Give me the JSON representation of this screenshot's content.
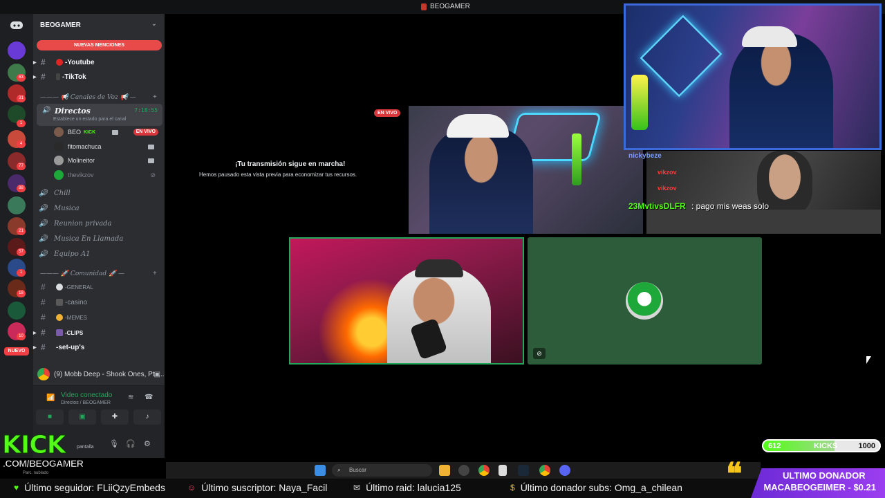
{
  "window": {
    "title": "BEOGAMER"
  },
  "rail": {
    "server_badges": [
      "63",
      "31",
      "1",
      "4",
      "77",
      "88",
      "21",
      "57",
      "1",
      "18",
      "10",
      "83"
    ],
    "nuevo_label": "NUEVO"
  },
  "sidebar": {
    "guild_name": "BEOGAMER",
    "chevron": "⌄",
    "mentions_label": "NUEVAS MENCIONES",
    "text_channels_top": [
      {
        "label": "-Youtube"
      },
      {
        "label": "-TikTok"
      }
    ],
    "voice_category": "——— 📢 Canales de Voz 📢 —",
    "directos": {
      "label": "Directos",
      "timer": "7:18:55",
      "status_placeholder": "Establece un estado para el canal"
    },
    "voice_users": [
      {
        "name": "BEO",
        "tag": "KICK",
        "live": "EN VIVO"
      },
      {
        "name": "fitomachuca"
      },
      {
        "name": "Molineitor"
      },
      {
        "name": "thevikzov"
      }
    ],
    "voice_channels": [
      {
        "label": "Chill"
      },
      {
        "label": "Musica"
      },
      {
        "label": "Reunion privada"
      },
      {
        "label": "Musica En Llamada"
      },
      {
        "label": "Equipo A1"
      }
    ],
    "community_category": "——— 🚀 Comunidad 🚀 —",
    "community_channels": [
      {
        "label": "-GENERAL"
      },
      {
        "label": "-casino"
      },
      {
        "label": "-MEMES"
      },
      {
        "label": "-CLIPS"
      },
      {
        "label": "-set-up's"
      }
    ],
    "now_playing": "(9) Mobb Deep - Shook Ones, Pt. ...",
    "voice_panel": {
      "status": "Video conectado",
      "location": "Directos / BEOGAMER"
    },
    "userbar": {
      "screen_label": "pantalla"
    }
  },
  "stage": {
    "live_tag": "EN VIVO",
    "paused_title": "¡Tu transmisión sigue en marcha!",
    "paused_sub": "Hemos pausado esta vista previa para economizar tus recursos."
  },
  "chat_overlay": {
    "line1": "nickybeze",
    "name2": "vikzov",
    "name3": "vikzov",
    "user": "23MvtivsDLFR",
    "message": ": pago mis weas solo"
  },
  "kick_brand": {
    "logo": "KICK",
    "url": ".COM/BEOGAMER",
    "weather": "Parc. nublado"
  },
  "kicks_goal": {
    "current": "612",
    "label": "KICKS",
    "target": "1000",
    "progress_fraction": 0.612
  },
  "taskbar": {
    "search_placeholder": "Buscar"
  },
  "ticker": {
    "follower": "Último seguidor: FLiiQzyEmbeds",
    "subscriber": "Último suscriptor: Naya_Facil",
    "raid": "Último raid: lalucia125",
    "donor_subs": "Último donador subs: Omg_a_chilean"
  },
  "donor_box": {
    "title": "ULTIMO DONADOR",
    "value": "MACABEOGEIMER - $0.21"
  },
  "colors": {
    "discord_bg": "#2b2d31",
    "rail_bg": "#1e1f22",
    "accent_green": "#23a55a",
    "kick_green": "#53fc18",
    "live_red": "#da373c",
    "donor_purple": "#9b3df0"
  }
}
